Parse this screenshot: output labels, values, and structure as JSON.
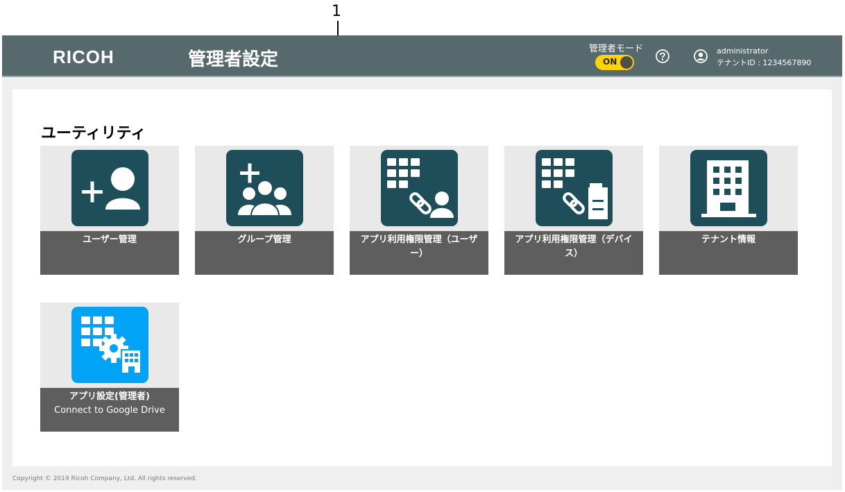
{
  "annotation": {
    "callout_number": "1"
  },
  "header": {
    "logo": "RICOH",
    "title": "管理者設定",
    "mode_label": "管理者モード",
    "mode_toggle": "ON",
    "user_name": "administrator",
    "tenant_id": "テナントID : 1234567890"
  },
  "section": {
    "title": "ユーティリティ"
  },
  "tiles": [
    {
      "label": "ユーザー管理",
      "icon": "add-user-icon"
    },
    {
      "label": "グループ管理",
      "icon": "add-group-icon"
    },
    {
      "label": "アプリ利用権限管理（ユーザー）",
      "icon": "app-user-permission-icon"
    },
    {
      "label": "アプリ利用権限管理（デバイス）",
      "icon": "app-device-permission-icon"
    },
    {
      "label": "テナント情報",
      "icon": "building-icon"
    },
    {
      "label": "アプリ設定(管理者)",
      "sublabel": "Connect to Google Drive",
      "icon": "app-settings-icon"
    }
  ],
  "footer": {
    "copyright": "Copyright © 2019 Ricoh Company, Ltd. All rights reserved."
  },
  "colors": {
    "header_bg": "#566a6d",
    "tile_icon_bg": "#1f4e5b",
    "tile_icon_bg_alt": "#00a3f5",
    "tile_label_bg": "#5e5e5e",
    "toggle_on": "#ffd400"
  }
}
